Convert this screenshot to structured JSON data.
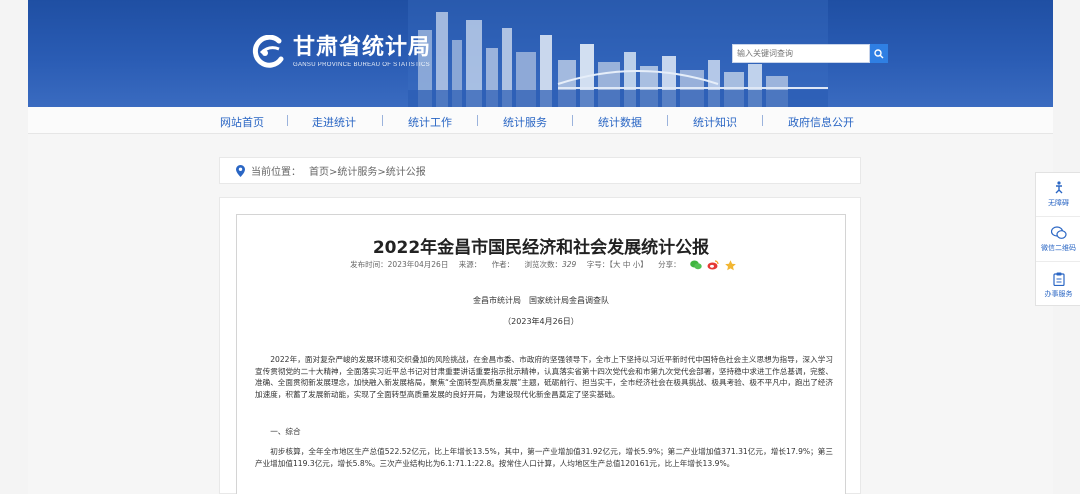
{
  "header": {
    "logo_cn": "甘肃省统计局",
    "logo_en": "GANSU PROVINCE BUREAU OF STATISTICS",
    "search_placeholder": "输入关键词查询",
    "brand_color": "#2a5cb4"
  },
  "nav": {
    "items": [
      "网站首页",
      "走进统计",
      "统计工作",
      "统计服务",
      "统计数据",
      "统计知识",
      "政府信息公开"
    ]
  },
  "breadcrumb": {
    "label": "当前位置：",
    "path": "首页>统计服务>统计公报"
  },
  "article": {
    "title": "2022年金昌市国民经济和社会发展统计公报",
    "publish_label": "发布时间：2023年04月26日",
    "source_label": "来源：",
    "author_label": "作者：",
    "views_label": "浏览次数：",
    "views_count": "329",
    "font_label": "字号：【大 中 小】",
    "share_label": "分享：",
    "authors": "金昌市统计局　国家统计局金昌调查队",
    "date": "（2023年4月26日）",
    "para1": "2022年，面对复杂严峻的发展环境和交织叠加的风险挑战，在金昌市委、市政府的坚强领导下，全市上下坚持以习近平新时代中国特色社会主义思想为指导，深入学习宣传贯彻党的二十大精神，全面落实习近平总书记对甘肃重要讲话重要指示批示精神，认真落实省第十四次党代会和市第九次党代会部署，坚持稳中求进工作总基调，完整、准确、全面贯彻新发展理念，加快融入新发展格局，聚焦“全面转型高质量发展”主题，砥砺前行、担当实干，全市经济社会在极具挑战、极具考验、极不平凡中，跑出了经济加速度，积蓄了发展新动能，实现了全面转型高质量发展的良好开局，为建设现代化新金昌奠定了坚实基础。",
    "section1": "一、综合",
    "para2": "初步核算，全年全市地区生产总值522.52亿元，比上年增长13.5%，其中，第一产业增加值31.92亿元，增长5.9%；第二产业增加值371.31亿元，增长17.9%；第三产业增加值119.3亿元，增长5.8%。三次产业结构比为6.1:71.1:22.8。按常住人口计算，人均地区生产总值120161元，比上年增长13.9%。"
  },
  "sidebar": {
    "items": [
      {
        "label": "无障碍",
        "icon": "accessibility-icon"
      },
      {
        "label": "微信二维码",
        "icon": "wechat-icon"
      },
      {
        "label": "办事服务",
        "icon": "clipboard-icon"
      }
    ]
  }
}
